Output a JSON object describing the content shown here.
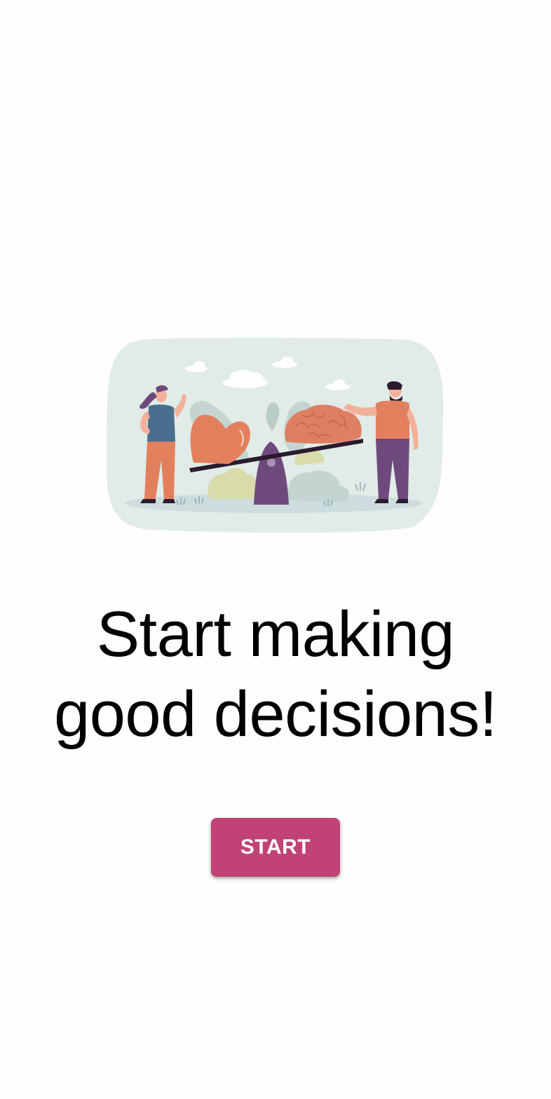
{
  "illustration": {
    "name": "heart-brain-seesaw-illustration",
    "colors": {
      "background": "#e1ebe7",
      "heart": "#e2805e",
      "brain": "#df7f62",
      "fulcrum": "#6e4a7c",
      "plank": "#2b1b2e",
      "leaf": "#c9d9d5",
      "bush": "#d8dcaa"
    }
  },
  "headline": {
    "line1": "Start making",
    "line2": "good decisions!"
  },
  "start_button": {
    "label": "START",
    "color": "#c04276"
  }
}
